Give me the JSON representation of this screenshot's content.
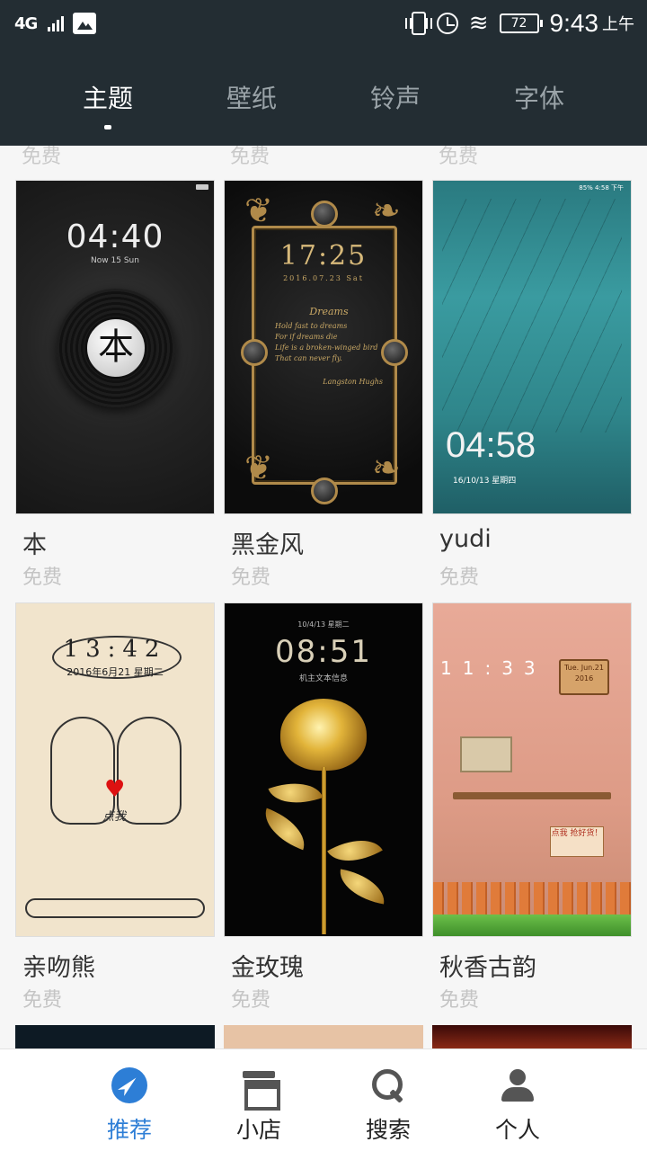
{
  "status_bar": {
    "network": "4G",
    "battery": "72",
    "time": "9:43",
    "ampm": "上午"
  },
  "tabs": [
    {
      "label": "主题",
      "active": true
    },
    {
      "label": "壁纸",
      "active": false
    },
    {
      "label": "铃声",
      "active": false
    },
    {
      "label": "字体",
      "active": false
    }
  ],
  "prev_row_prices": [
    "免费",
    "免费",
    "免费"
  ],
  "themes": [
    {
      "name": "本",
      "price": "免费",
      "preview_time": "04:40",
      "preview_date": "Now 15 Sun",
      "preview_glyph": "本"
    },
    {
      "name": "黑金风",
      "price": "免费",
      "preview_time": "17:25",
      "preview_date": "2016.07.23  Sat",
      "preview_poem": [
        "Dreams",
        "Hold fast to dreams",
        "For if dreams die",
        "Life is a broken-winged bird",
        "That can never fly.",
        "Langston Hughs"
      ]
    },
    {
      "name": "yudi",
      "price": "免费",
      "preview_time": "04:58",
      "preview_date": "16/10/13  星期四",
      "preview_status": "85%  4:58 下午"
    },
    {
      "name": "亲吻熊",
      "price": "免费",
      "preview_time": "13:42",
      "preview_date": "2016年6月21  星期二",
      "preview_text": "点我"
    },
    {
      "name": "金玫瑰",
      "price": "免费",
      "preview_time": "08:51",
      "preview_date": "10/4/13  星期二",
      "preview_sub": "机主文本信息"
    },
    {
      "name": "秋香古韵",
      "price": "免费",
      "preview_time": "11:33",
      "preview_sign": "Tue. Jun.21 2016",
      "preview_note": "点我 抢好货！"
    }
  ],
  "bottom_nav": [
    {
      "label": "推荐",
      "icon": "compass-icon",
      "active": true
    },
    {
      "label": "小店",
      "icon": "store-icon",
      "active": false
    },
    {
      "label": "搜索",
      "icon": "search-icon",
      "active": false
    },
    {
      "label": "个人",
      "icon": "person-icon",
      "active": false
    }
  ],
  "colors": {
    "header_bg": "#232d33",
    "accent": "#2d7ed6",
    "price_gray": "#c4c4c4"
  }
}
